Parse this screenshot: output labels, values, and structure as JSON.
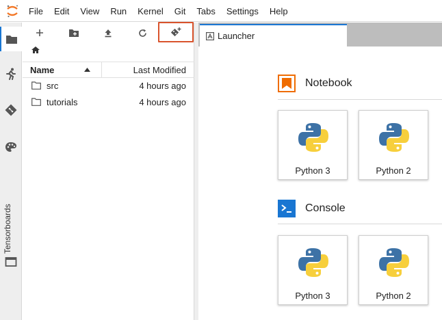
{
  "menu": [
    "File",
    "Edit",
    "View",
    "Run",
    "Kernel",
    "Git",
    "Tabs",
    "Settings",
    "Help"
  ],
  "activity": {
    "vertical_label": "Tensorboards"
  },
  "filebrowser": {
    "columns": {
      "name": "Name",
      "modified": "Last Modified"
    },
    "files": [
      {
        "name": "src",
        "modified": "4 hours ago"
      },
      {
        "name": "tutorials",
        "modified": "4 hours ago"
      }
    ],
    "highlight_color": "#d9532c"
  },
  "tab": {
    "label": "Launcher"
  },
  "launcher": {
    "notebook": {
      "title": "Notebook",
      "kernels": [
        "Python 3",
        "Python 2"
      ]
    },
    "console": {
      "title": "Console",
      "kernels": [
        "Python 3",
        "Python 2"
      ]
    }
  },
  "colors": {
    "accent": "#1976d2",
    "notebook_icon": "#ef6c00",
    "console_icon": "#1976d2"
  }
}
